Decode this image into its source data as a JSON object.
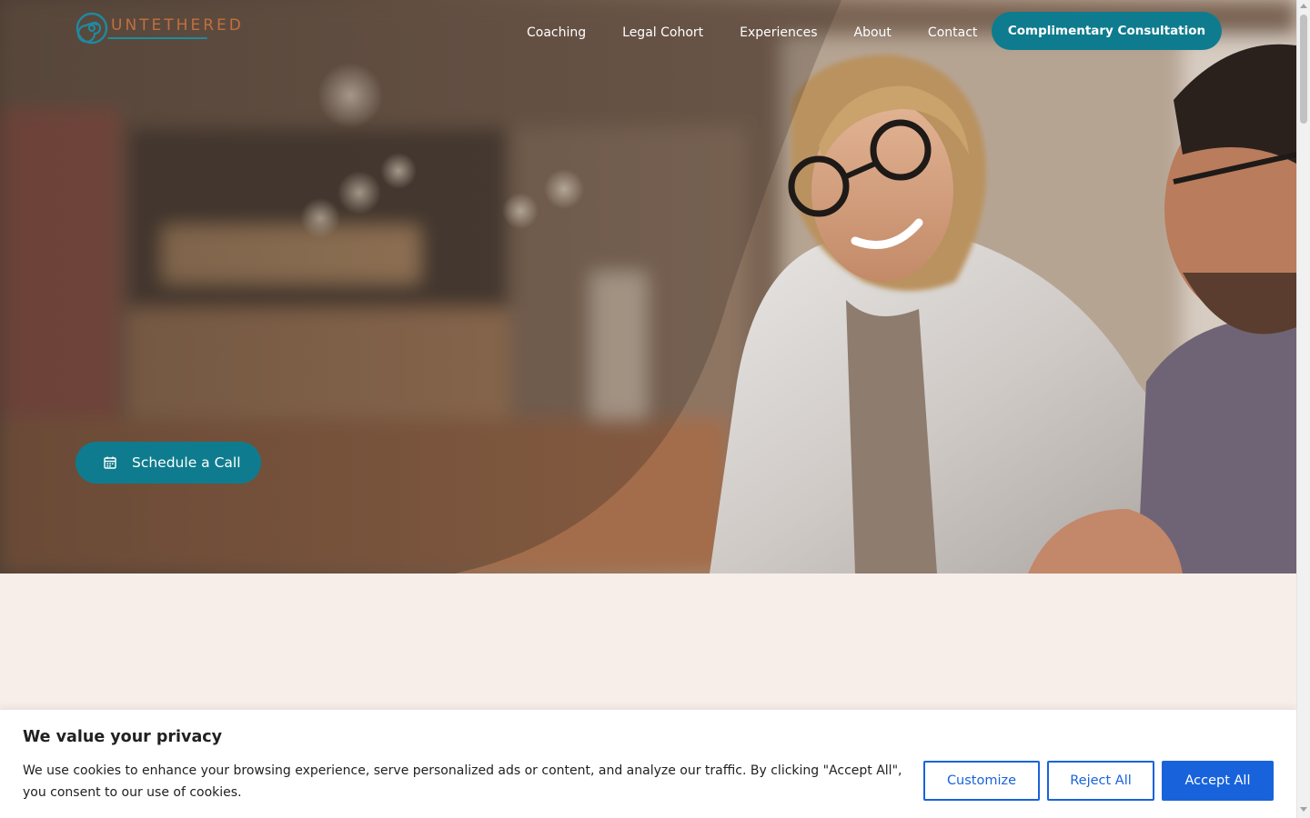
{
  "brand": {
    "name": "UNTETHERED",
    "primary_color": "#0e7c8e",
    "accent_color": "#c0703f"
  },
  "nav": {
    "items": [
      {
        "label": "Coaching"
      },
      {
        "label": "Legal Cohort"
      },
      {
        "label": "Experiences"
      },
      {
        "label": "About"
      },
      {
        "label": "Contact"
      }
    ],
    "cta_label": "Complimentary Consultation"
  },
  "hero": {
    "schedule_label": "Schedule a Call",
    "schedule_icon": "calendar-icon"
  },
  "cookie_banner": {
    "title": "We value your privacy",
    "text": "We use cookies to enhance your browsing experience, serve personalized ads or content, and analyze our traffic. By clicking \"Accept All\", you consent to our use of cookies.",
    "buttons": {
      "customize": "Customize",
      "reject": "Reject All",
      "accept": "Accept All"
    },
    "button_color": "#1863dc"
  }
}
